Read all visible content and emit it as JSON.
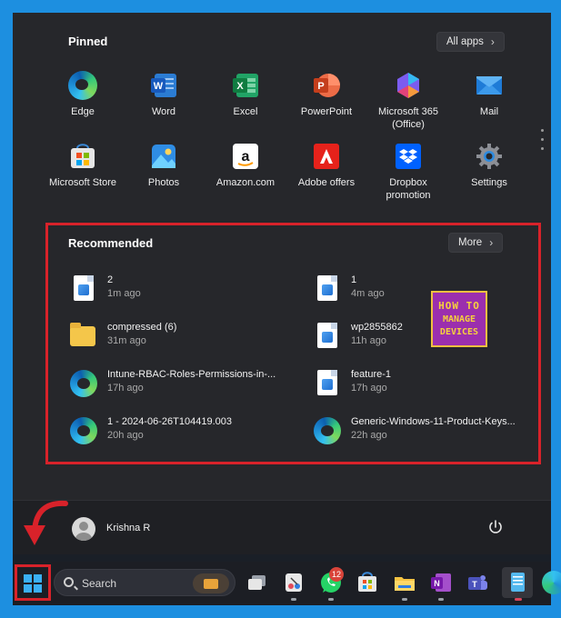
{
  "pinned": {
    "title": "Pinned",
    "all_apps_label": "All apps",
    "apps": [
      {
        "label": "Edge",
        "icon": "edge-icon"
      },
      {
        "label": "Word",
        "icon": "word-icon"
      },
      {
        "label": "Excel",
        "icon": "excel-icon"
      },
      {
        "label": "PowerPoint",
        "icon": "powerpoint-icon"
      },
      {
        "label": "Microsoft 365 (Office)",
        "icon": "microsoft-365-icon"
      },
      {
        "label": "Mail",
        "icon": "mail-icon"
      },
      {
        "label": "Microsoft Store",
        "icon": "microsoft-store-icon"
      },
      {
        "label": "Photos",
        "icon": "photos-icon"
      },
      {
        "label": "Amazon.com",
        "icon": "amazon-icon"
      },
      {
        "label": "Adobe offers",
        "icon": "adobe-icon"
      },
      {
        "label": "Dropbox promotion",
        "icon": "dropbox-icon"
      },
      {
        "label": "Settings",
        "icon": "settings-gear-icon"
      }
    ]
  },
  "recommended": {
    "title": "Recommended",
    "more_label": "More",
    "items": [
      {
        "name": "2",
        "time": "1m ago",
        "icon": "image-file-icon"
      },
      {
        "name": "1",
        "time": "4m ago",
        "icon": "image-file-icon"
      },
      {
        "name": "compressed (6)",
        "time": "31m ago",
        "icon": "zip-folder-icon"
      },
      {
        "name": "wp2855862",
        "time": "11h ago",
        "icon": "image-file-icon"
      },
      {
        "name": "Intune-RBAC-Roles-Permissions-in-...",
        "time": "17h ago",
        "icon": "edge-document-icon"
      },
      {
        "name": "feature-1",
        "time": "17h ago",
        "icon": "image-file-icon"
      },
      {
        "name": "1 - 2024-06-26T104419.003",
        "time": "20h ago",
        "icon": "edge-document-icon"
      },
      {
        "name": "Generic-Windows-11-Product-Keys...",
        "time": "22h ago",
        "icon": "edge-document-icon"
      }
    ]
  },
  "watermark": {
    "line1": "HOW TO",
    "line2": "MANAGE",
    "line3": "DEVICES"
  },
  "user": {
    "name": "Krishna R"
  },
  "taskbar": {
    "search_placeholder": "Search",
    "whatsapp_badge": "12"
  },
  "colors": {
    "highlight_red": "#d8222a",
    "frame_blue": "#1d8fe0",
    "menu_bg": "#26272b"
  }
}
